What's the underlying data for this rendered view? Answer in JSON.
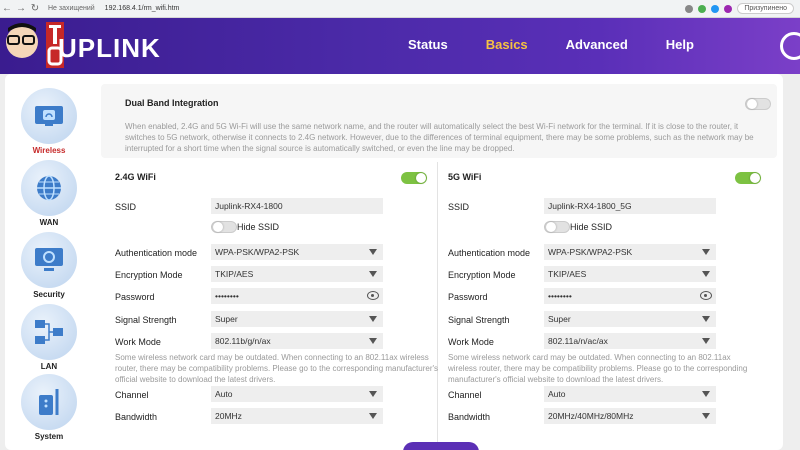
{
  "browser": {
    "insecure_label": "Не захищений",
    "url": "192.168.4.1/rm_wifi.htm",
    "user_chip": "Призупинено"
  },
  "header": {
    "logo": "UPLINK",
    "nav": [
      {
        "label": "Status"
      },
      {
        "label": "Basics"
      },
      {
        "label": "Advanced"
      },
      {
        "label": "Help"
      }
    ]
  },
  "sidebar": {
    "items": [
      {
        "label": "Wireless"
      },
      {
        "label": "WAN"
      },
      {
        "label": "Security"
      },
      {
        "label": "LAN"
      },
      {
        "label": "System"
      }
    ]
  },
  "dual_band": {
    "title": "Dual Band Integration",
    "enabled": false,
    "description": "When enabled, 2.4G and 5G Wi-Fi will use the same network name, and the router will automatically select the best Wi-Fi network for the terminal. If it is close to the router, it switches to 5G network, otherwise it connects to 2.4G network. However, due to the differences of terminal equipment, there may be some problems, such as the network may be interrupted for a short time when the signal source is automatically switched, or even the line may be dropped."
  },
  "labels": {
    "ssid": "SSID",
    "hide_ssid": "Hide SSID",
    "auth_mode": "Authentication mode",
    "encryption": "Encryption Mode",
    "password": "Password",
    "signal": "Signal Strength",
    "work_mode": "Work Mode",
    "channel": "Channel",
    "bandwidth": "Bandwidth"
  },
  "wifi24": {
    "title": "2.4G WiFi",
    "enabled": true,
    "ssid": "Juplink-RX4-1800",
    "auth_mode": "WPA-PSK/WPA2-PSK",
    "encryption": "TKIP/AES",
    "password": "••••••••",
    "signal": "Super",
    "work_mode": "802.11b/g/n/ax",
    "note": "Some wireless network card may be outdated. When connecting to an 802.11ax wireless router, there may be compatibility problems. Please go to the corresponding manufacturer's official website to download the latest drivers.",
    "channel": "Auto",
    "bandwidth": "20MHz"
  },
  "wifi5": {
    "title": "5G WiFi",
    "enabled": true,
    "ssid": "Juplink-RX4-1800_5G",
    "auth_mode": "WPA-PSK/WPA2-PSK",
    "encryption": "TKIP/AES",
    "password": "••••••••",
    "signal": "Super",
    "work_mode": "802.11a/n/ac/ax",
    "note": "Some wireless network card may be outdated. When connecting to an 802.11ax wireless router, there may be compatibility problems. Please go to the corresponding manufacturer's official website to download the latest drivers.",
    "channel": "Auto",
    "bandwidth": "20MHz/40MHz/80MHz"
  },
  "colors": {
    "accent": "#f6c342",
    "header_start": "#3a1c8f",
    "toggle_on": "#7dc242",
    "active_side": "#c62828"
  }
}
